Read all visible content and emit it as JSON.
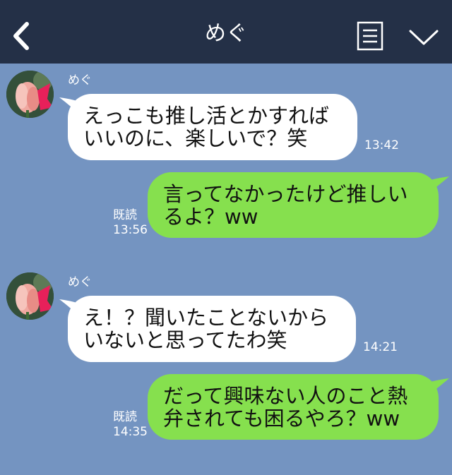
{
  "header": {
    "title": "めぐ",
    "back_icon": "chevron-left-icon",
    "notes_icon": "notes-icon",
    "menu_icon": "chevron-down-icon",
    "bg_color": "#243047"
  },
  "chat": {
    "bg_color": "#7494c1",
    "incoming_bubble_color": "#ffffff",
    "outgoing_bubble_color": "#86e04e",
    "messages": [
      {
        "direction": "incoming",
        "sender": "めぐ",
        "lines": [
          "えっこも推し活とかすれば",
          "いいのに、楽しいで？笑"
        ],
        "time": "13:42"
      },
      {
        "direction": "outgoing",
        "read_label": "既読",
        "lines": [
          "言ってなかったけど推しい",
          "るよ？ww"
        ],
        "time": "13:56"
      },
      {
        "direction": "incoming",
        "sender": "めぐ",
        "lines": [
          "え！？聞いたことないから",
          "いないと思ってたわ笑"
        ],
        "time": "14:21"
      },
      {
        "direction": "outgoing",
        "read_label": "既読",
        "lines": [
          "だって興味ない人のこと熱",
          "弁されても困るやろ？ww"
        ],
        "time": "14:35"
      }
    ]
  }
}
